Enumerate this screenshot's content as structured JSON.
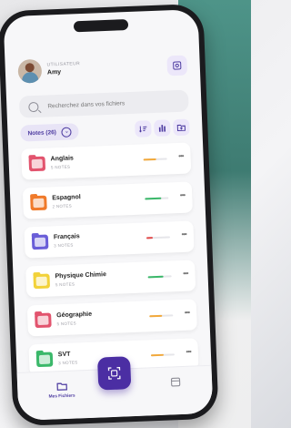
{
  "user": {
    "role": "UTILISATEUR",
    "name": "Amy"
  },
  "search": {
    "placeholder": "Recherchez dans vos fichiers"
  },
  "toolbar": {
    "notes_label": "Notes (26)"
  },
  "subjects": [
    {
      "name": "Anglais",
      "count": "5 NOTES",
      "color": "#e2546e",
      "progress": 0.55,
      "progress_color": "#f2a93b"
    },
    {
      "name": "Espagnol",
      "count": "2 NOTES",
      "color": "#f07a2a",
      "progress": 0.7,
      "progress_color": "#3bb86a"
    },
    {
      "name": "Français",
      "count": "3 NOTES",
      "color": "#6a5ed8",
      "progress": 0.25,
      "progress_color": "#e24b4b"
    },
    {
      "name": "Physique Chimie",
      "count": "5 NOTES",
      "color": "#f2d23a",
      "progress": 0.65,
      "progress_color": "#3bb86a"
    },
    {
      "name": "Géographie",
      "count": "5 NOTES",
      "color": "#e2546e",
      "progress": 0.55,
      "progress_color": "#f2a93b"
    },
    {
      "name": "SVT",
      "count": "3 NOTES",
      "color": "#3bb86a",
      "progress": 0.55,
      "progress_color": "#f2a93b"
    }
  ],
  "tabs": {
    "files_label": "Mes Fichiers"
  },
  "colors": {
    "accent": "#4b2ea3",
    "accent_light": "#ece7fa"
  }
}
